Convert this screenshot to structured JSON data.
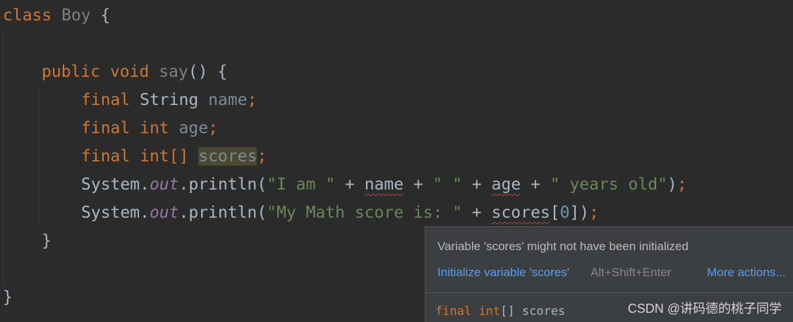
{
  "editor": {
    "line1": {
      "kw": "class",
      "name": "Boy",
      "brace": " {"
    },
    "line3": {
      "kw1": "public",
      "kw2": "void",
      "method": "say",
      "rest": "() {"
    },
    "line4": {
      "kw": "final",
      "type": "String",
      "var": "name",
      "semi": ";"
    },
    "line5": {
      "kw": "final",
      "type": "int",
      "var": "age",
      "semi": ";"
    },
    "line6": {
      "kw": "final",
      "type": "int[]",
      "var": "scores",
      "semi": ";"
    },
    "line7": {
      "sys": "System.",
      "field": "out",
      "call": ".println(",
      "s1": "\"I am \"",
      "p1": " + ",
      "v1": "name",
      "p2": " + ",
      "s2": "\" \"",
      "p3": " + ",
      "v2": "age",
      "p4": " + ",
      "s3": "\" years old\"",
      "end": ")",
      "semi": ";"
    },
    "line8": {
      "sys": "System.",
      "field": "out",
      "call": ".println(",
      "s1": "\"My Math score is: \"",
      "p1": " + ",
      "v1": "scores",
      "b1": "[",
      "num": "0",
      "b2": "])",
      "semi": ";"
    },
    "line9": {
      "brace": "}"
    },
    "line11": {
      "brace": "}"
    }
  },
  "popup": {
    "message": "Variable 'scores' might not have been initialized",
    "action": "Initialize variable 'scores'",
    "shortcut": "Alt+Shift+Enter",
    "more": "More actions...",
    "signature": {
      "kw": "final",
      "type": "int",
      "rest": "[] scores"
    }
  },
  "watermark": "CSDN @讲码德的桃子同学"
}
